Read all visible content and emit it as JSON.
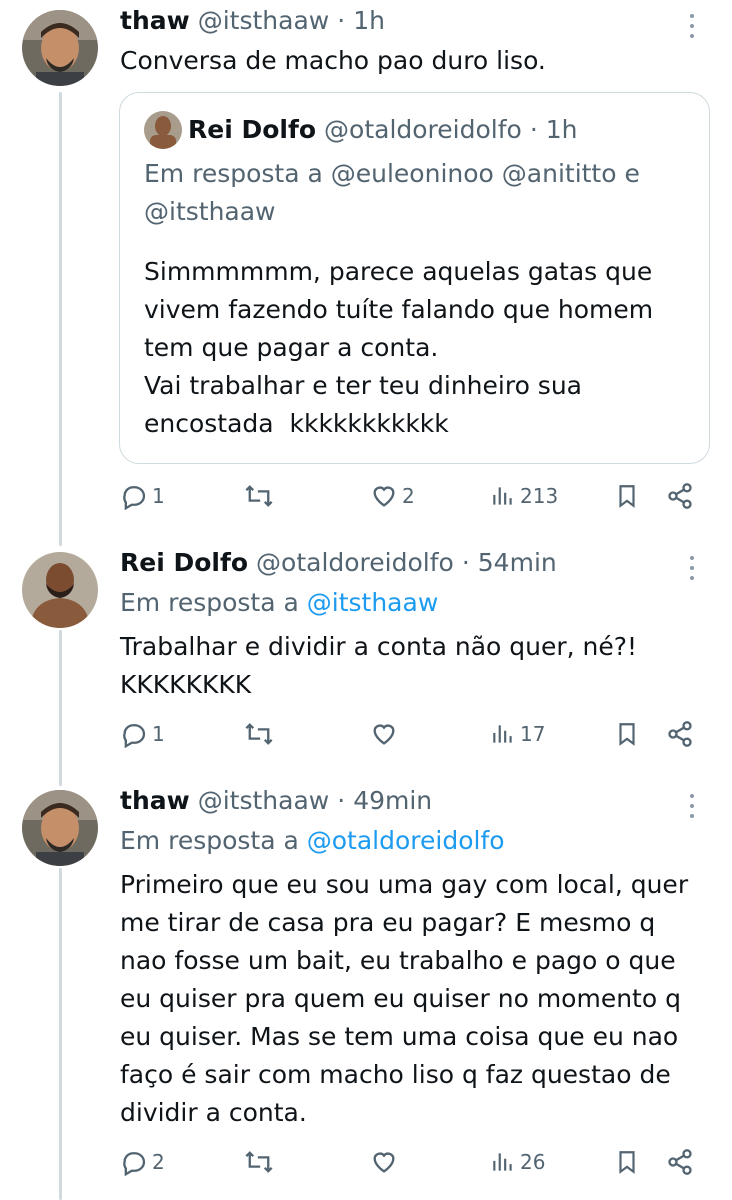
{
  "tweets": [
    {
      "name": "thaw",
      "handle": "@itsthaaw",
      "time": "1h",
      "text": "Conversa de macho pao duro liso.",
      "quote": {
        "name": "Rei Dolfo",
        "handle": "@otaldoreidolfo",
        "time": "1h",
        "reply_prefix": "Em resposta a @euleoninoo @anititto e",
        "reply_line2": "@itsthaaw",
        "text": "Simmmmmm, parece aquelas gatas que\nvivem fazendo tuíte falando que homem\ntem que pagar a conta.\nVai trabalhar e ter teu dinheiro sua\nencostada  kkkkkkkkkkk"
      },
      "stats": {
        "replies": "1",
        "retweets": "",
        "likes": "2",
        "views": "213"
      }
    },
    {
      "name": "Rei Dolfo",
      "handle": "@otaldoreidolfo",
      "time": "54min",
      "reply_prefix": "Em resposta a",
      "reply_to": "@itsthaaw",
      "text": "Trabalhar e dividir a conta não quer, né?!\nKKKKKKKK",
      "stats": {
        "replies": "1",
        "retweets": "",
        "likes": "",
        "views": "17"
      }
    },
    {
      "name": "thaw",
      "handle": "@itsthaaw",
      "time": "49min",
      "reply_prefix": "Em resposta a",
      "reply_to": "@otaldoreidolfo",
      "text": "Primeiro que eu sou uma gay com local, quer\nme tirar de casa pra eu pagar? E mesmo q\nnao fosse um bait, eu trabalho e pago o que\neu quiser pra quem eu quiser no momento q\neu quiser. Mas se tem uma coisa que eu nao\nfaço é sair com macho liso q faz questao de\ndividir a conta.",
      "stats": {
        "replies": "2",
        "retweets": "",
        "likes": "",
        "views": "26"
      }
    }
  ],
  "separator": "·",
  "icons": [
    "reply-icon",
    "retweet-icon",
    "like-icon",
    "views-icon",
    "bookmark-icon",
    "share-icon",
    "more-icon"
  ],
  "colors": {
    "text": "#0f1419",
    "muted": "#536471",
    "link": "#1d9bf0",
    "line": "#cfd9de"
  }
}
